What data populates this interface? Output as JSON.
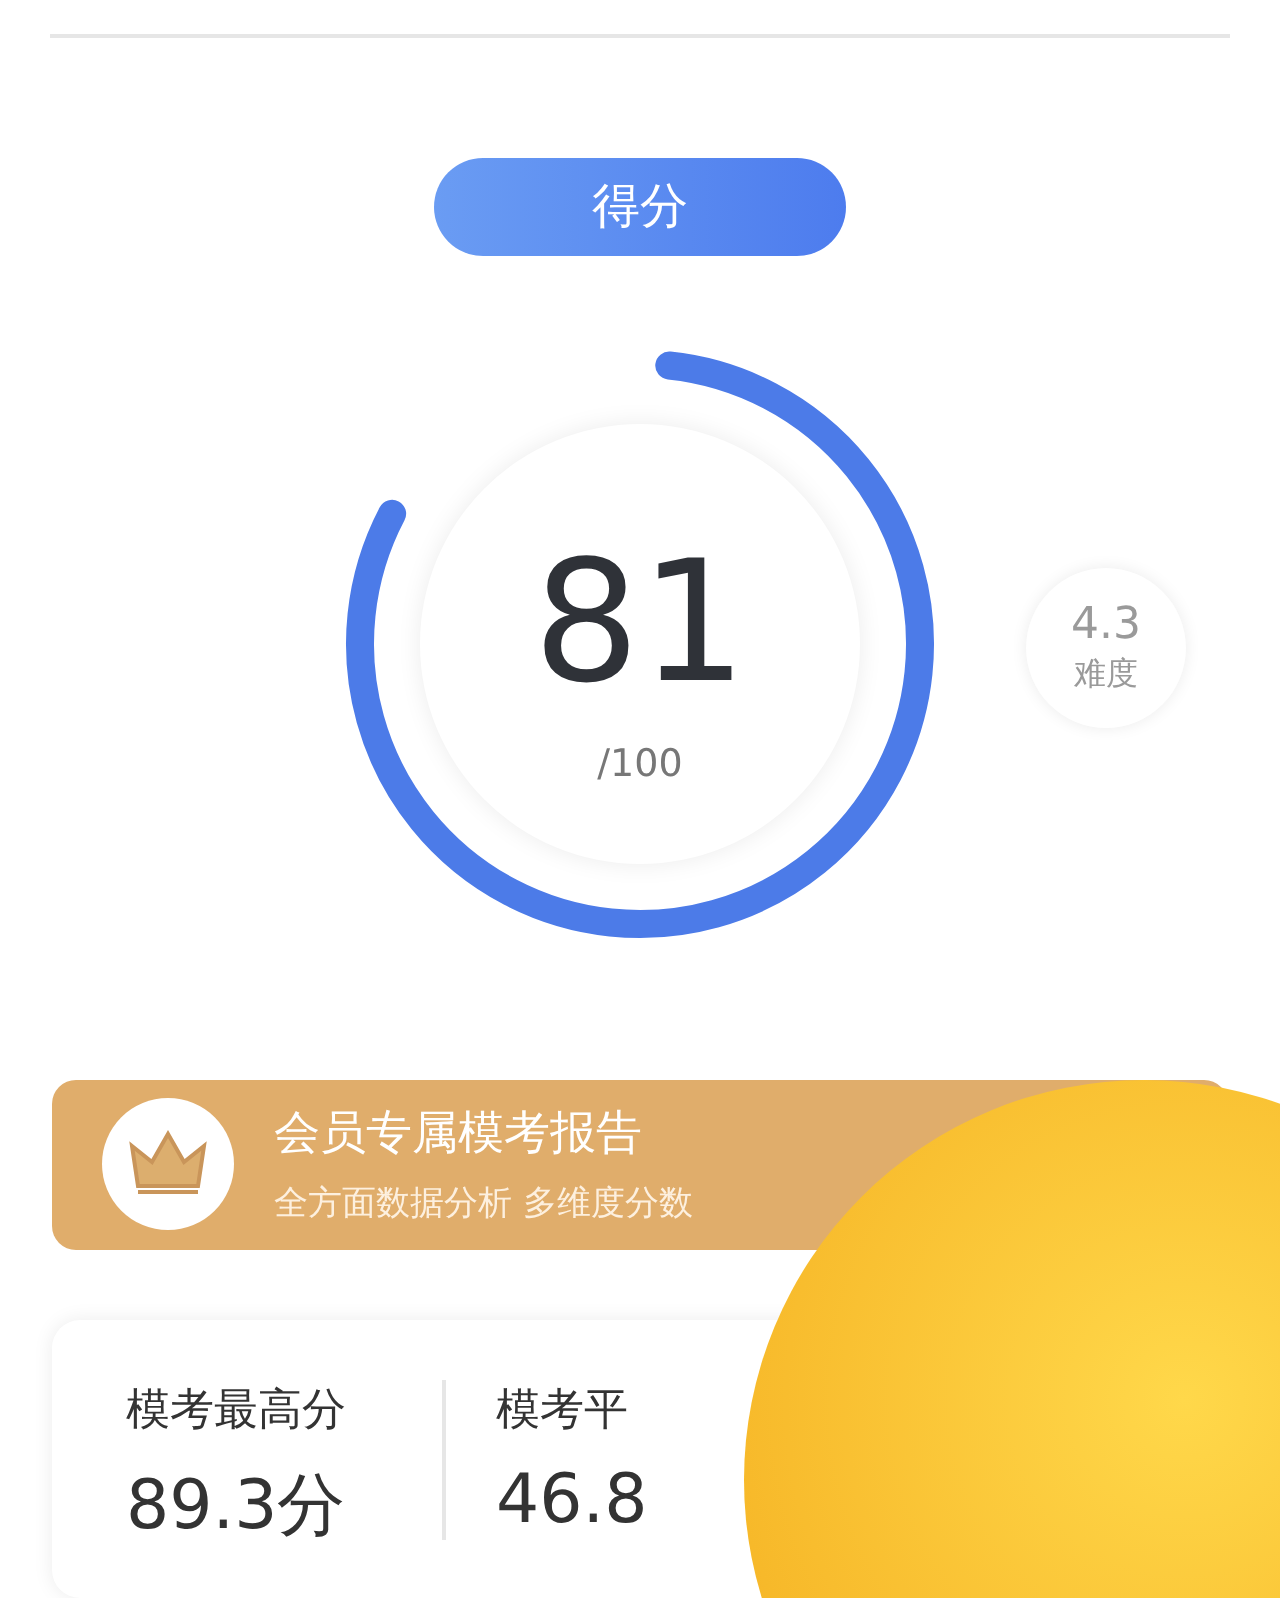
{
  "score_tab": {
    "label": "得分"
  },
  "score": {
    "value": "81",
    "total": "/100",
    "level": 0.81
  },
  "difficulty": {
    "value": "4.3",
    "label": "难度"
  },
  "member_banner": {
    "title": "会员专属模考报告",
    "subtitle": "全方面数据分析 多维度分数"
  },
  "stats": [
    {
      "label": "模考最高分",
      "value": "89.3分"
    },
    {
      "label": "模考平",
      "value": "46.8"
    }
  ]
}
